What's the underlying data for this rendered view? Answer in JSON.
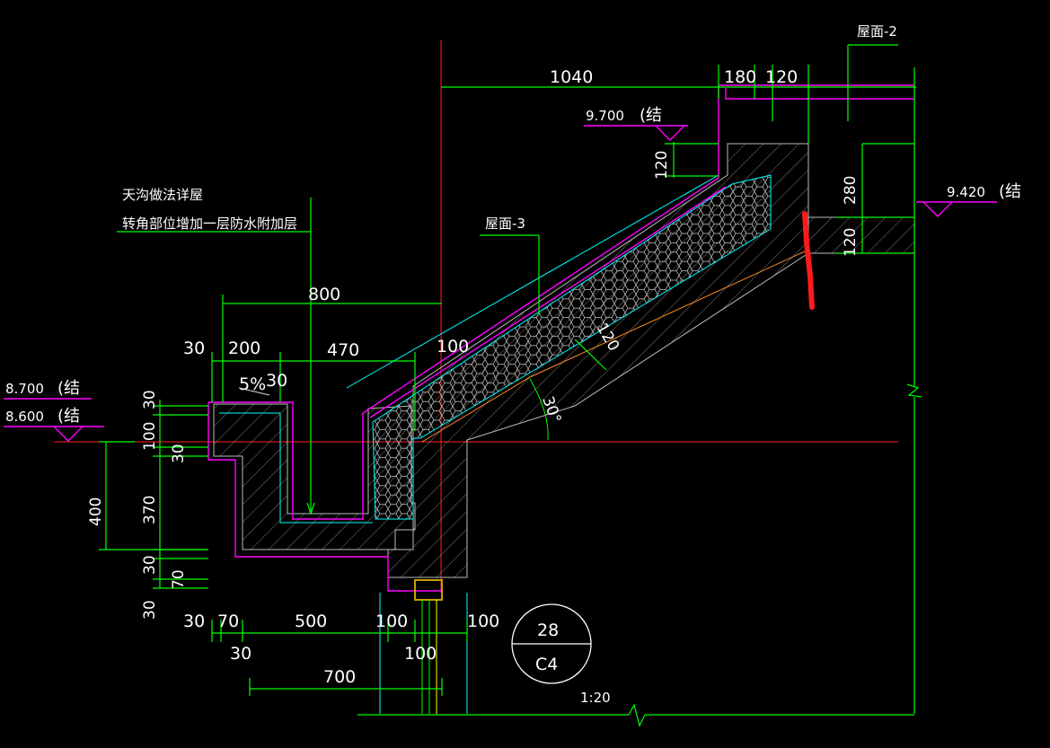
{
  "dimensions": {
    "top_1040": "1040",
    "top_180": "180",
    "top_120": "120",
    "v_120_upper": "120",
    "v_280": "280",
    "v_120_right": "120",
    "mid_800": "800",
    "left_30": "30",
    "left_200": "200",
    "mid_470": "470",
    "mid_100": "100",
    "slope_120": "120",
    "v_30_a": "30",
    "v_100": "100",
    "v_30_b": "30",
    "v_370": "370",
    "v_30_c": "30",
    "v_70": "70",
    "v_400": "400",
    "v_30_d": "30",
    "bot_30": "30",
    "bot_70": "70",
    "bot_500": "500",
    "bot_100_a": "100",
    "bot_100_b": "100",
    "bot_30_low": "30",
    "bot_100_low": "100",
    "bot_700": "700",
    "gutter_30": "30",
    "slope_5pct": "5%"
  },
  "elevations": {
    "e_9700": "9.700",
    "e_9700_suffix": "(结",
    "e_9420": "9.420",
    "e_9420_suffix": "(结",
    "e_8700": "8.700",
    "e_8700_suffix": "(结",
    "e_8600": "8.600",
    "e_8600_suffix": "(结"
  },
  "labels": {
    "roof_2": "屋面-2",
    "roof_3": "屋面-3",
    "note_line1": "天沟做法详屋",
    "note_line2": "转角部位增加一层防水附加层",
    "angle": "30°",
    "detail_number": "28",
    "detail_sheet": "C4",
    "scale": "1:20"
  },
  "colors": {
    "background": "#000000",
    "dimension": "#00ff00",
    "waterproof": "#ff00ff",
    "insulation": "#00ffff",
    "axis": "#ff2020",
    "annotation_mark": "#ff1a1a"
  }
}
